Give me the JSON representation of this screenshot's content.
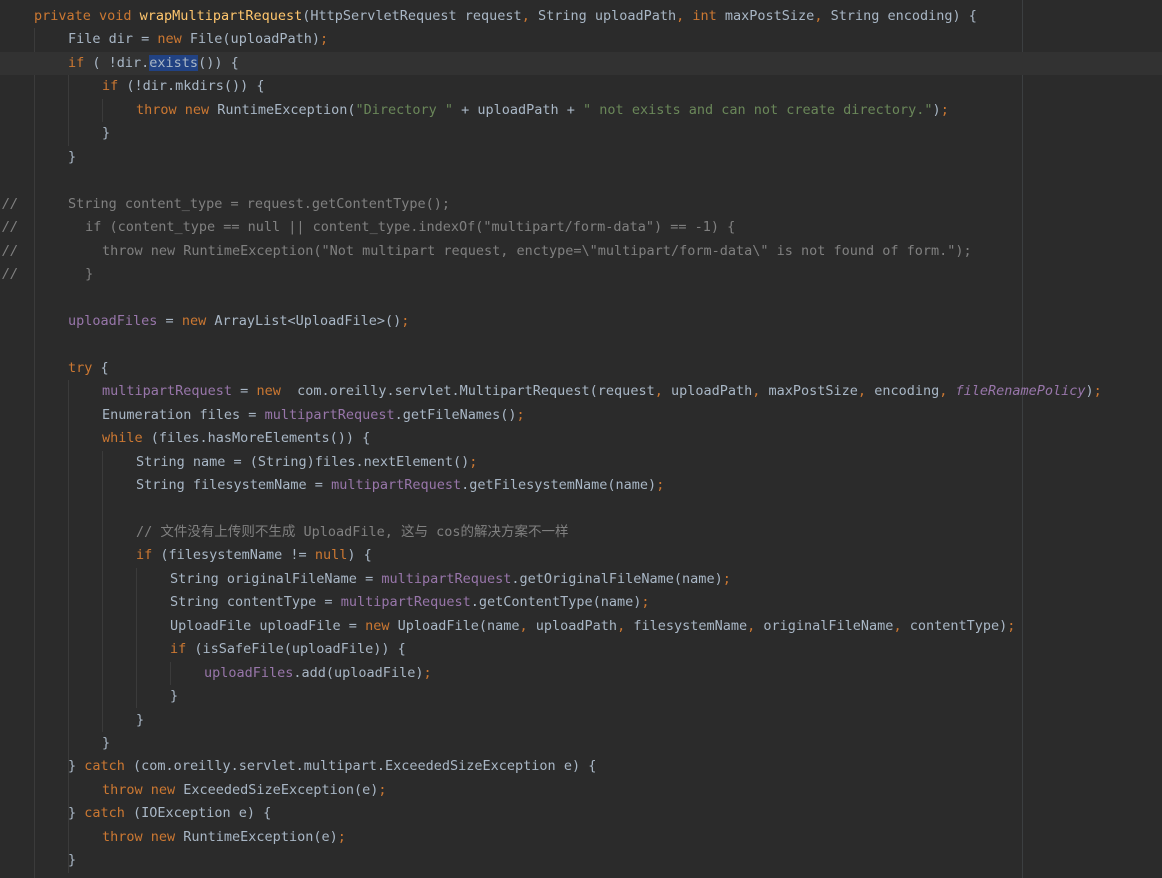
{
  "editor": {
    "theme": "darcula",
    "colors": {
      "background": "#2b2b2b",
      "keyword": "#cc7832",
      "string": "#6a8759",
      "field": "#9876aa",
      "method": "#ffc66d",
      "comment": "#808080",
      "selection": "#214283",
      "text": "#a9b7c6"
    },
    "gutter_marker": "//",
    "lines": [
      {
        "indent": 1,
        "tokens": [
          [
            "kw",
            "private void "
          ],
          [
            "mth",
            "wrapMultipartRequest"
          ],
          [
            "txt",
            "(HttpServletRequest request"
          ],
          [
            "pun",
            ", "
          ],
          [
            "txt",
            "String uploadPath"
          ],
          [
            "pun",
            ", "
          ],
          [
            "kw",
            "int "
          ],
          [
            "txt",
            "maxPostSize"
          ],
          [
            "pun",
            ", "
          ],
          [
            "txt",
            "String encoding) {"
          ]
        ]
      },
      {
        "indent": 2,
        "tokens": [
          [
            "txt",
            "File dir = "
          ],
          [
            "kw",
            "new "
          ],
          [
            "txt",
            "File(uploadPath)"
          ],
          [
            "pun",
            ";"
          ]
        ]
      },
      {
        "indent": 2,
        "current": true,
        "tokens": [
          [
            "kw",
            "if "
          ],
          [
            "txt",
            "( !dir."
          ],
          [
            "hl",
            "exists"
          ],
          [
            "txt",
            "()) {"
          ]
        ]
      },
      {
        "indent": 3,
        "tokens": [
          [
            "kw",
            "if "
          ],
          [
            "txt",
            "(!dir.mkdirs()) {"
          ]
        ]
      },
      {
        "indent": 4,
        "tokens": [
          [
            "kw",
            "throw new "
          ],
          [
            "txt",
            "RuntimeException("
          ],
          [
            "str",
            "\"Directory \" "
          ],
          [
            "txt",
            "+ uploadPath + "
          ],
          [
            "str",
            "\" not exists and can not create directory.\""
          ],
          [
            "txt",
            ")"
          ],
          [
            "pun",
            ";"
          ]
        ]
      },
      {
        "indent": 3,
        "tokens": [
          [
            "txt",
            "}"
          ]
        ]
      },
      {
        "indent": 2,
        "tokens": [
          [
            "txt",
            "}"
          ]
        ]
      },
      {
        "indent": 0,
        "tokens": []
      },
      {
        "indent": 2,
        "commented": true,
        "tokens": [
          [
            "cmt",
            "String content_type = request.getContentType();"
          ]
        ]
      },
      {
        "indent": 2,
        "commented": true,
        "extra": "  ",
        "tokens": [
          [
            "cmt",
            "if (content_type == null || content_type.indexOf(\"multipart/form-data\") == -1) {"
          ]
        ]
      },
      {
        "indent": 3,
        "commented": true,
        "tokens": [
          [
            "cmt",
            "throw new RuntimeException(\"Not multipart request, enctype=\\\"multipart/form-data\\\" is not found of form.\");"
          ]
        ]
      },
      {
        "indent": 2,
        "commented": true,
        "extra": "  ",
        "tokens": [
          [
            "cmt",
            "}"
          ]
        ]
      },
      {
        "indent": 0,
        "tokens": []
      },
      {
        "indent": 2,
        "tokens": [
          [
            "fld",
            "uploadFiles "
          ],
          [
            "txt",
            "= "
          ],
          [
            "kw",
            "new "
          ],
          [
            "txt",
            "ArrayList<UploadFile>()"
          ],
          [
            "pun",
            ";"
          ]
        ]
      },
      {
        "indent": 0,
        "tokens": []
      },
      {
        "indent": 2,
        "tokens": [
          [
            "kw",
            "try "
          ],
          [
            "txt",
            "{"
          ]
        ]
      },
      {
        "indent": 3,
        "tokens": [
          [
            "fld",
            "multipartRequest "
          ],
          [
            "txt",
            "= "
          ],
          [
            "kw",
            "new  "
          ],
          [
            "txt",
            "com.oreilly.servlet.MultipartRequest(request"
          ],
          [
            "pun",
            ", "
          ],
          [
            "txt",
            "uploadPath"
          ],
          [
            "pun",
            ", "
          ],
          [
            "txt",
            "maxPostSize"
          ],
          [
            "pun",
            ", "
          ],
          [
            "txt",
            "encoding"
          ],
          [
            "pun",
            ", "
          ],
          [
            "fld-i",
            "fileRenamePolicy"
          ],
          [
            "txt",
            ")"
          ],
          [
            "pun",
            ";"
          ]
        ]
      },
      {
        "indent": 3,
        "tokens": [
          [
            "txt",
            "Enumeration files = "
          ],
          [
            "fld",
            "multipartRequest"
          ],
          [
            "txt",
            ".getFileNames()"
          ],
          [
            "pun",
            ";"
          ]
        ]
      },
      {
        "indent": 3,
        "tokens": [
          [
            "kw",
            "while "
          ],
          [
            "txt",
            "(files.hasMoreElements()) {"
          ]
        ]
      },
      {
        "indent": 4,
        "tokens": [
          [
            "txt",
            "String name = (String)files.nextElement()"
          ],
          [
            "pun",
            ";"
          ]
        ]
      },
      {
        "indent": 4,
        "tokens": [
          [
            "txt",
            "String filesystemName = "
          ],
          [
            "fld",
            "multipartRequest"
          ],
          [
            "txt",
            ".getFilesystemName(name)"
          ],
          [
            "pun",
            ";"
          ]
        ]
      },
      {
        "indent": 0,
        "tokens": []
      },
      {
        "indent": 4,
        "tokens": [
          [
            "cmt-line",
            "// 文件没有上传则不生成 UploadFile, 这与 cos的解决方案不一样"
          ]
        ]
      },
      {
        "indent": 4,
        "tokens": [
          [
            "kw",
            "if "
          ],
          [
            "txt",
            "(filesystemName != "
          ],
          [
            "kw",
            "null"
          ],
          [
            "txt",
            ") {"
          ]
        ]
      },
      {
        "indent": 5,
        "tokens": [
          [
            "txt",
            "String originalFileName = "
          ],
          [
            "fld",
            "multipartRequest"
          ],
          [
            "txt",
            ".getOriginalFileName(name)"
          ],
          [
            "pun",
            ";"
          ]
        ]
      },
      {
        "indent": 5,
        "tokens": [
          [
            "txt",
            "String contentType = "
          ],
          [
            "fld",
            "multipartRequest"
          ],
          [
            "txt",
            ".getContentType(name)"
          ],
          [
            "pun",
            ";"
          ]
        ]
      },
      {
        "indent": 5,
        "tokens": [
          [
            "txt",
            "UploadFile uploadFile = "
          ],
          [
            "kw",
            "new "
          ],
          [
            "txt",
            "UploadFile(name"
          ],
          [
            "pun",
            ", "
          ],
          [
            "txt",
            "uploadPath"
          ],
          [
            "pun",
            ", "
          ],
          [
            "txt",
            "filesystemName"
          ],
          [
            "pun",
            ", "
          ],
          [
            "txt",
            "originalFileName"
          ],
          [
            "pun",
            ", "
          ],
          [
            "txt",
            "contentType)"
          ],
          [
            "pun",
            ";"
          ]
        ]
      },
      {
        "indent": 5,
        "tokens": [
          [
            "kw",
            "if "
          ],
          [
            "txt",
            "(isSafeFile(uploadFile)) {"
          ]
        ]
      },
      {
        "indent": 6,
        "tokens": [
          [
            "fld",
            "uploadFiles"
          ],
          [
            "txt",
            ".add(uploadFile)"
          ],
          [
            "pun",
            ";"
          ]
        ]
      },
      {
        "indent": 5,
        "tokens": [
          [
            "txt",
            "}"
          ]
        ]
      },
      {
        "indent": 4,
        "tokens": [
          [
            "txt",
            "}"
          ]
        ]
      },
      {
        "indent": 3,
        "tokens": [
          [
            "txt",
            "}"
          ]
        ]
      },
      {
        "indent": 2,
        "tokens": [
          [
            "txt",
            "} "
          ],
          [
            "kw",
            "catch "
          ],
          [
            "txt",
            "(com.oreilly.servlet.multipart.ExceededSizeException e) {"
          ]
        ]
      },
      {
        "indent": 3,
        "tokens": [
          [
            "kw",
            "throw new "
          ],
          [
            "txt",
            "ExceededSizeException(e)"
          ],
          [
            "pun",
            ";"
          ]
        ]
      },
      {
        "indent": 2,
        "tokens": [
          [
            "txt",
            "} "
          ],
          [
            "kw",
            "catch "
          ],
          [
            "txt",
            "(IOException e) {"
          ]
        ]
      },
      {
        "indent": 3,
        "tokens": [
          [
            "kw",
            "throw new "
          ],
          [
            "txt",
            "RuntimeException(e)"
          ],
          [
            "pun",
            ";"
          ]
        ]
      },
      {
        "indent": 2,
        "tokens": [
          [
            "txt",
            "}"
          ]
        ]
      }
    ]
  }
}
